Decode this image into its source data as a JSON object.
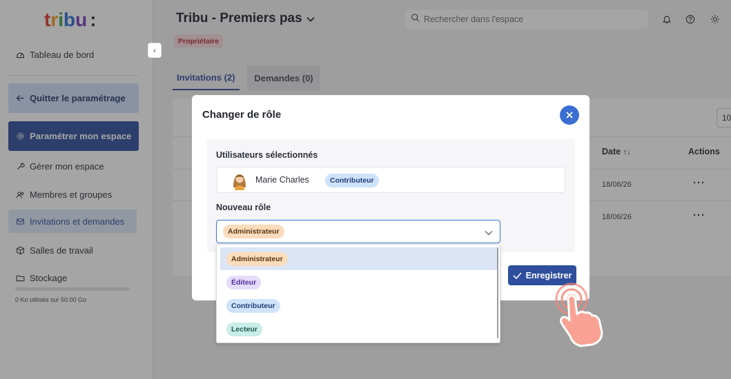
{
  "brand": {
    "logo_text": "tribu:"
  },
  "sidebar": {
    "dashboard": "Tableau de bord",
    "quit": "Quitter le paramétrage",
    "configure": "Paramétrer mon espace",
    "manage": "Gérer mon espace",
    "members": "Membres et groupes",
    "invitations": "Invitations et demandes",
    "rooms": "Salles de travail",
    "storage": "Stockage",
    "storage_usage": "0 Ko utilisés sur 50.00 Go",
    "storage_used_fraction": 0
  },
  "header": {
    "title": "Tribu - Premiers pas",
    "role_badge": "Propriétaire",
    "search_placeholder": "Rechercher dans l'espace"
  },
  "tabs": [
    {
      "label": "Invitations (2)",
      "active": true
    },
    {
      "label": "Demandes (0)",
      "active": false
    }
  ],
  "table": {
    "headers": {
      "date": "Date",
      "actions": "Actions"
    },
    "rows": [
      {
        "date": "18/06/26",
        "actions": "···"
      },
      {
        "date": "18/06/26",
        "actions": "···"
      }
    ],
    "pager_value": "10"
  },
  "modal": {
    "title": "Changer de rôle",
    "selected_users_label": "Utilisateurs sélectionnés",
    "user": {
      "name": "Marie Charles",
      "role": "Contributeur"
    },
    "new_role_label": "Nouveau rôle",
    "selected_role": "Administrateur",
    "save_label": "Enregistrer"
  },
  "dropdown": {
    "options": [
      "Administrateur",
      "Éditeur",
      "Contributeur",
      "Lecteur"
    ],
    "selected_index": 0
  },
  "colors": {
    "primary": "#2f4f9d",
    "accent": "#3c6fd3",
    "owner_badge_bg": "#f9d9dc",
    "admin_badge_bg": "#fbdcbc",
    "editor_badge_bg": "#e5dbfb",
    "contrib_badge_bg": "#cfe3fb",
    "reader_badge_bg": "#c9ede8",
    "pointer": "#f5877a"
  }
}
